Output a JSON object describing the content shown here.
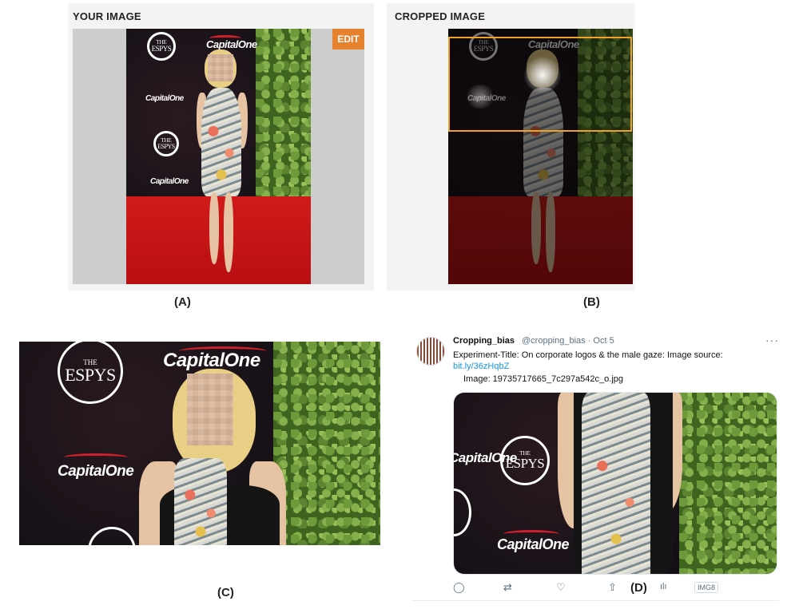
{
  "panel_a": {
    "title": "YOUR IMAGE",
    "edit_label": "EDIT",
    "caption": "(A)"
  },
  "panel_b": {
    "title": "CROPPED IMAGE",
    "caption": "(B)"
  },
  "panel_c": {
    "caption": "(C)"
  },
  "panel_d": {
    "caption": "(D)"
  },
  "logos": {
    "espys_small": "THE",
    "espys_big": "ESPYS",
    "capital_one": "CapitalOne"
  },
  "tweet": {
    "display_name": "Cropping_bias",
    "handle_date": "@cropping_bias · Oct 5",
    "text": "Experiment-Title: On corporate logos & the male gaze: Image source:",
    "link": "bit.ly/36zHqbZ",
    "image_line": "Image: 19735717665_7c297a542c_o.jpg",
    "more": "···",
    "actions": {
      "reply": "◯",
      "retweet": "⇄",
      "like": "♡",
      "share": "⇧",
      "analytics": "ılı",
      "badge": "IMG8"
    }
  },
  "colors": {
    "accent_edit": "#e6812d",
    "crop_border": "#f0a224",
    "link": "#1b95e0",
    "carpet": "#c8141a"
  }
}
